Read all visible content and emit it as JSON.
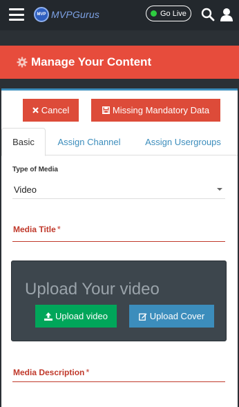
{
  "nav": {
    "logo_badge": "MVP",
    "logo_text": "MVPGurus",
    "golive_label": "Go Live",
    "icons": [
      "hamburger-icon",
      "search-icon",
      "user-icon"
    ]
  },
  "banner": {
    "title": "Manage Your Content",
    "icon": "gear-icon"
  },
  "actions": {
    "cancel_label": "Cancel",
    "missing_label": "Missing Mandatory Data"
  },
  "tabs": [
    {
      "label": "Basic",
      "active": true
    },
    {
      "label": "Assign Channel",
      "active": false
    },
    {
      "label": "Assign Usergroups",
      "active": false
    }
  ],
  "form": {
    "type_label": "Type of Media",
    "type_value": "Video",
    "media_title_label": "Media Title",
    "required_mark": "*",
    "upload_headline": "Upload Your video",
    "upload_video_label": "Upload video",
    "upload_cover_label": "Upload Cover",
    "media_description_label": "Media Description"
  },
  "colors": {
    "accent_red": "#e74c3c",
    "button_red": "#dd4b39",
    "link_blue": "#3c8dbc",
    "upload_green": "#00a65a",
    "nav_bg": "#23282d"
  }
}
